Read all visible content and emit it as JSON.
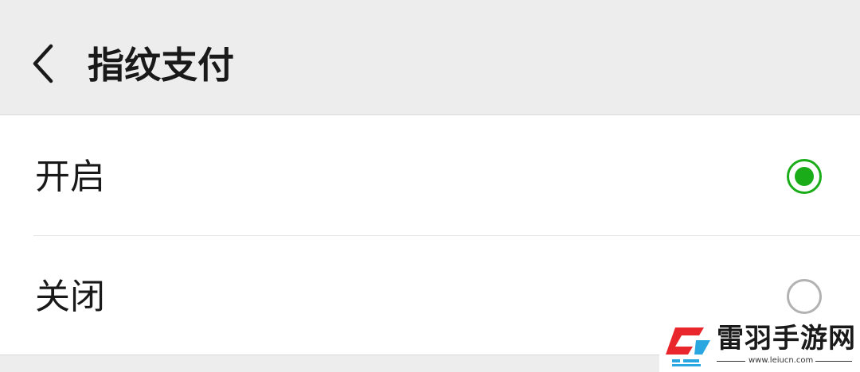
{
  "header": {
    "back_icon": "chevron-left-icon",
    "title": "指纹支付"
  },
  "options": [
    {
      "label": "开启",
      "selected": true
    },
    {
      "label": "关闭",
      "selected": false
    }
  ],
  "colors": {
    "header_bg": "#ededed",
    "accent_green": "#1aad19",
    "radio_unchecked": "#b2b2b2",
    "text": "#191919"
  },
  "watermark": {
    "name": "雷羽手游网",
    "url": "www.leiucn.com",
    "logo_icon": "leiyu-logo-icon",
    "logo_colors": [
      "#e8262b",
      "#2aa6e0"
    ]
  }
}
